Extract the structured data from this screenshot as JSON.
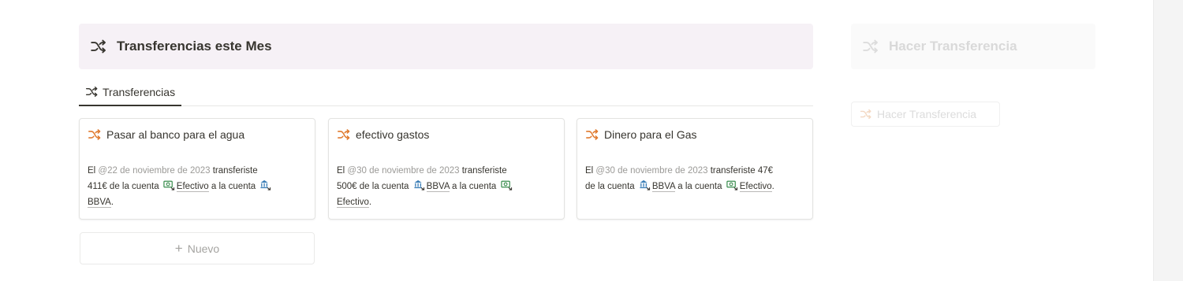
{
  "colors": {
    "accent_orange": "#e07a2e",
    "callout_bg": "#f6f1f6",
    "text": "#37352f",
    "muted": "#9b9a97"
  },
  "main_callout": {
    "icon": "shuffle-icon",
    "title": "Transferencias este Mes"
  },
  "side_callout": {
    "icon": "shuffle-icon",
    "title": "Hacer Transferencia"
  },
  "side_button": {
    "icon": "shuffle-icon",
    "label": "Hacer Transferencia"
  },
  "tabs": [
    {
      "icon": "shuffle-icon",
      "label": "Transferencias",
      "active": true
    }
  ],
  "cards": [
    {
      "title": "Pasar al banco para el agua",
      "prefix": "El ",
      "date": "@22 de noviembre de 2023",
      "verb": " transferiste",
      "amount": "411€",
      "from_text": " de la cuenta ",
      "from_icon": "cash-icon",
      "from_account": "Efectivo",
      "to_text": " a la cuenta ",
      "to_icon": "bank-icon",
      "to_account": "BBVA",
      "end": "."
    },
    {
      "title": "efectivo gastos",
      "prefix": "El ",
      "date": "@30 de noviembre de 2023",
      "verb": " transferiste",
      "amount": "500€",
      "from_text": " de la cuenta ",
      "from_icon": "bank-icon",
      "from_account": "BBVA",
      "to_text": " a la cuenta ",
      "to_icon": "cash-icon",
      "to_account": "Efectivo",
      "end": "."
    },
    {
      "title": "Dinero para el Gas",
      "prefix": "El ",
      "date": "@30 de noviembre de 2023",
      "verb": " transferiste",
      "amount": "47€",
      "from_text": " de la cuenta ",
      "from_icon": "bank-icon",
      "from_account": "BBVA",
      "to_text": " a la cuenta ",
      "to_icon": "cash-icon",
      "to_account": "Efectivo",
      "end": "."
    }
  ],
  "new_button": {
    "plus": "+",
    "label": "Nuevo"
  }
}
